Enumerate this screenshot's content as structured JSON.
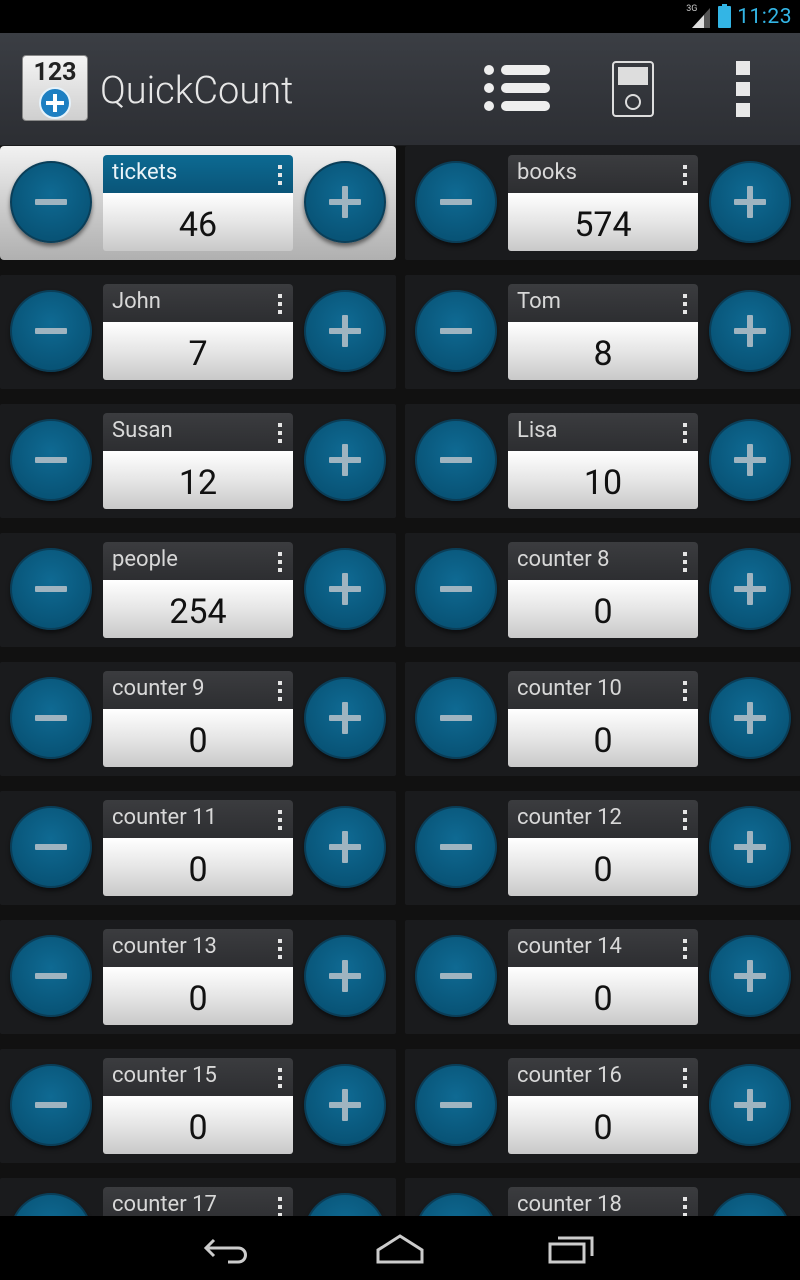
{
  "status_bar": {
    "network": "3G",
    "time": "11:23"
  },
  "app": {
    "title": "QuickCount",
    "icon_text": "123"
  },
  "action_bar": [
    "list-icon",
    "device-icon",
    "overflow-menu-icon"
  ],
  "counters": [
    {
      "name": "tickets",
      "value": "46"
    },
    {
      "name": "books",
      "value": "574"
    },
    {
      "name": "John",
      "value": "7"
    },
    {
      "name": "Tom",
      "value": "8"
    },
    {
      "name": "Susan",
      "value": "12"
    },
    {
      "name": "Lisa",
      "value": "10"
    },
    {
      "name": "people",
      "value": "254"
    },
    {
      "name": "counter 8",
      "value": "0"
    },
    {
      "name": "counter 9",
      "value": "0"
    },
    {
      "name": "counter 10",
      "value": "0"
    },
    {
      "name": "counter 11",
      "value": "0"
    },
    {
      "name": "counter 12",
      "value": "0"
    },
    {
      "name": "counter 13",
      "value": "0"
    },
    {
      "name": "counter 14",
      "value": "0"
    },
    {
      "name": "counter 15",
      "value": "0"
    },
    {
      "name": "counter 16",
      "value": "0"
    },
    {
      "name": "counter 17",
      "value": ""
    },
    {
      "name": "counter 18",
      "value": ""
    }
  ],
  "selected_counter": "tickets",
  "colors": {
    "accent": "#0b5f86",
    "clock": "#33b5e5"
  },
  "nav_bar": [
    "back-icon",
    "home-icon",
    "recent-apps-icon"
  ]
}
